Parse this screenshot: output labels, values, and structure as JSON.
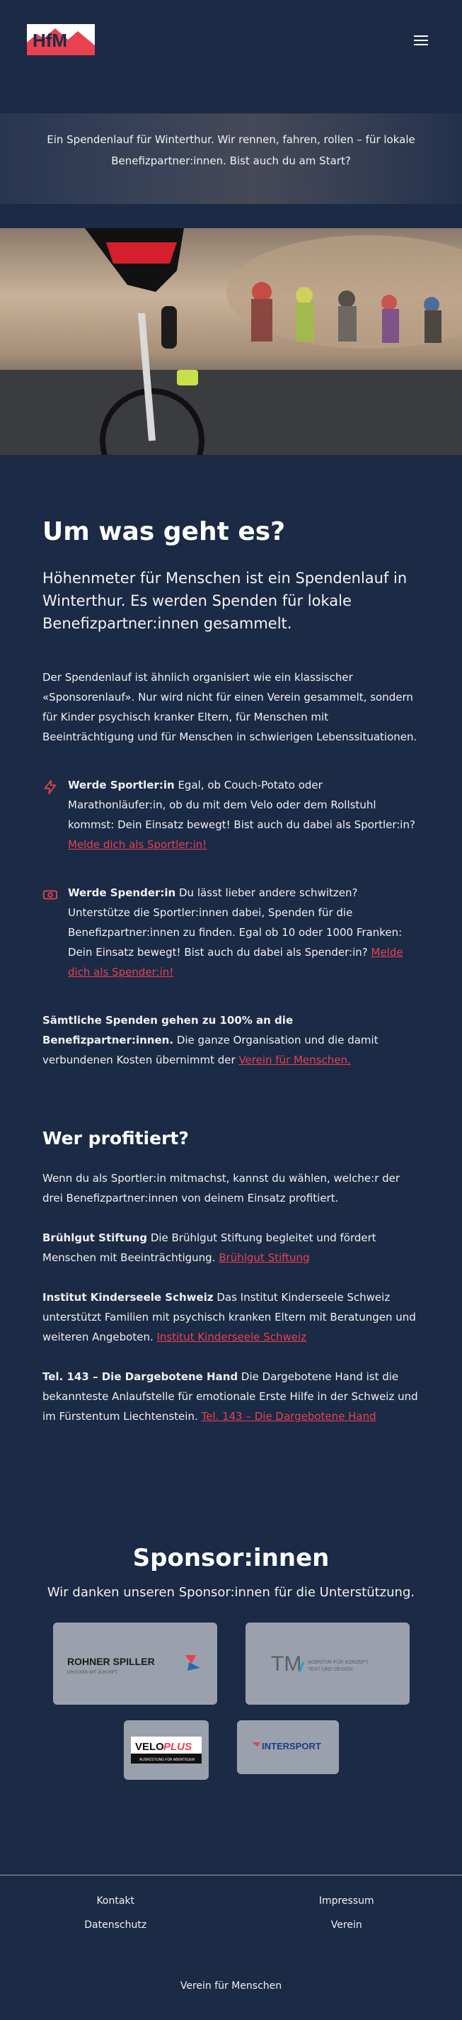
{
  "header": {
    "logo_alt": "HfM",
    "menu_icon": "hamburger-menu-icon"
  },
  "hero": {
    "text": "Ein Spendenlauf für Winterthur. Wir rennen, fahren, rollen – für lokale Benefizpartner:innen. Bist auch du am Start?"
  },
  "about": {
    "title": "Um was geht es?",
    "lead": "Höhenmeter für Menschen ist ein Spendenlauf in Winterthur. Es werden Spenden für lokale Benefizpartner:innen gesammelt.",
    "intro": "Der Spendenlauf ist ähnlich organisiert wie ein klassischer «Sponsorenlauf». Nur wird nicht für einen Verein gesammelt, sondern für Kinder psychisch kranker Eltern, für Menschen mit Beeinträchtigung und für Menschen in schwierigen Lebenssituationen.",
    "sportler": {
      "strong": "Werde Sportler:in",
      "text": " Egal, ob Couch-Potato oder Marathonläufer:in, ob du mit dem Velo oder dem Rollstuhl kommst: Dein Einsatz bewegt! Bist auch du dabei als Sportler:in? ",
      "link": "Melde dich als Sportler:in!"
    },
    "spender": {
      "strong": "Werde Spender:in",
      "text": " Du lässt lieber andere schwitzen? Unterstütze die Sportler:innen dabei, Spenden für die Benefizpartner:innen zu finden. Egal ob 10 oder 1000 Franken: Dein Einsatz bewegt! Bist auch du dabei als Spender:in? ",
      "link": "Melde dich als Spender:in!"
    },
    "donations": {
      "strong": "Sämtliche Spenden gehen zu 100% an die Benefizpartner:innen.",
      "text": " Die ganze Organisation und die damit verbundenen Kosten übernimmt der ",
      "link": "Verein für Menschen."
    }
  },
  "profit": {
    "title": "Wer profitiert?",
    "intro": "Wenn du als Sportler:in mitmachst, kannst du wählen, welche:r der drei Benefizpartner:innen von deinem Einsatz profitiert.",
    "partners": [
      {
        "name": "Brühlgut Stiftung",
        "text": " Die Brühlgut Stiftung begleitet und fördert Menschen mit Beeinträchtigung. ",
        "link": "Brühlgut Stiftung"
      },
      {
        "name": "Institut Kinderseele Schweiz",
        "text": " Das Institut Kinderseele Schweiz unterstützt Familien mit psychisch kranken Eltern mit Beratungen und weiteren Angeboten. ",
        "link": "Institut Kinderseele Schweiz"
      },
      {
        "name": "Tel. 143 – Die Dargebotene Hand",
        "text": " Die Dargebotene Hand ist die bekannteste Anlaufstelle für emotionale Erste Hilfe in der Schweiz und im Fürstentum Liechtenstein. ",
        "link": "Tel. 143 – Die Dargebotene Hand"
      }
    ]
  },
  "sponsors": {
    "title": "Sponsor:innen",
    "subtitle": "Wir danken unseren Sponsor:innen für die Unterstützung.",
    "logos": {
      "rohner": "ROHNER SPILLER",
      "rohner_sub": "DRUCKEN MIT ZUKUNFT",
      "tm": "TM",
      "tm_sub1": "AGENTUR FÜR KONZEPT,",
      "tm_sub2": "TEXT UND DESIGN",
      "velo": "VELO",
      "velo_plus": "PLUS",
      "velo_sub": "AUSRÜSTUNG FÜR ABENTEUER",
      "intersport": "INTERSPORT"
    }
  },
  "footer": {
    "links": [
      "Kontakt",
      "Impressum",
      "Datenschutz",
      "Verein"
    ],
    "bottom": "Verein für Menschen"
  },
  "colors": {
    "background": "#1b2a45",
    "accent": "#e8414f",
    "card": "#9aa1ac"
  }
}
